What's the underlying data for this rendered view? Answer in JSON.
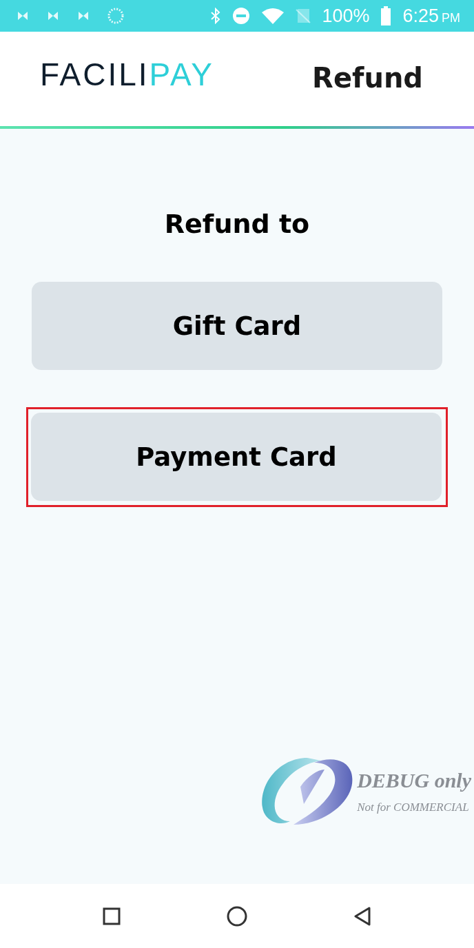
{
  "status_bar": {
    "battery": "100%",
    "time": "6:25",
    "meridiem": "PM"
  },
  "header": {
    "logo_parts": [
      "FACILI",
      "PAY"
    ],
    "title": "Refund"
  },
  "heading": "Refund to",
  "options": [
    {
      "label": "Gift Card",
      "highlighted": false
    },
    {
      "label": "Payment Card",
      "highlighted": true
    }
  ],
  "debug_badge": {
    "title": "DEBUG only",
    "subtitle": "Not for COMMERCIAL"
  }
}
